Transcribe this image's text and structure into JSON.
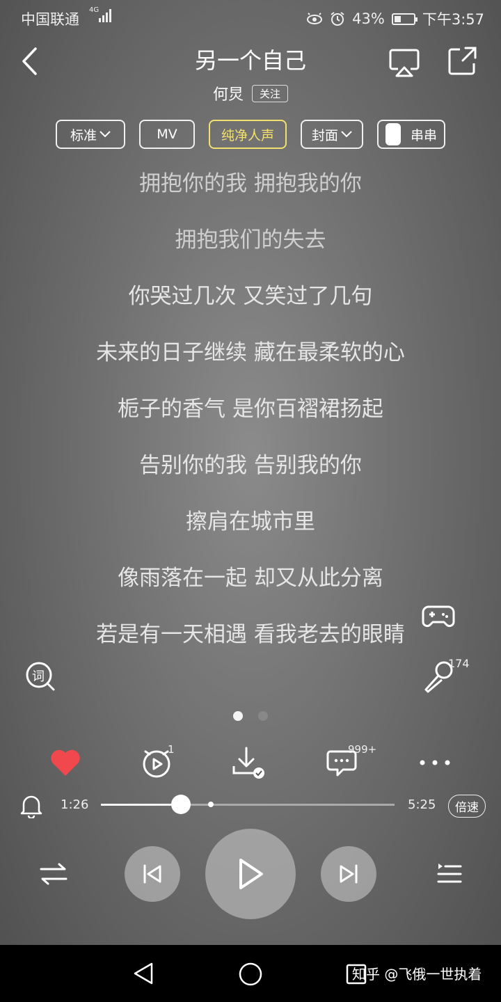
{
  "status_bar": {
    "carrier": "中国联通",
    "network": "4G",
    "battery": "43%",
    "battery_level": 0.43,
    "time": "下午3:57"
  },
  "header": {
    "title": "另一个自己",
    "artist": "何炅",
    "follow_label": "关注"
  },
  "chips": {
    "quality": "标准",
    "mv": "MV",
    "pure_vocal": "纯净人声",
    "cover": "封面",
    "chuanchuan": "串串"
  },
  "lyrics": [
    "拥抱你的我  拥抱我的你",
    "拥抱我们的失去",
    "你哭过几次 又笑过了几句",
    "未来的日子继续 藏在最柔软的心",
    "栀子的香气 是你百褶裙扬起",
    "告别你的我 告别我的你",
    "擦肩在城市里",
    "像雨落在一起 却又从此分离",
    "若是有一天相遇 看我老去的眼睛"
  ],
  "side": {
    "lyric_icon_label": "词",
    "sing_count": "174"
  },
  "pager": {
    "pages": 2,
    "current": 1
  },
  "actions": {
    "track_count": "1",
    "comment_count": "999+"
  },
  "player": {
    "elapsed": "1:26",
    "duration": "5:25",
    "progress": 0.273,
    "buffered": 0.375,
    "speed_label": "倍速"
  },
  "watermark": "知乎 @飞俄一世执着"
}
